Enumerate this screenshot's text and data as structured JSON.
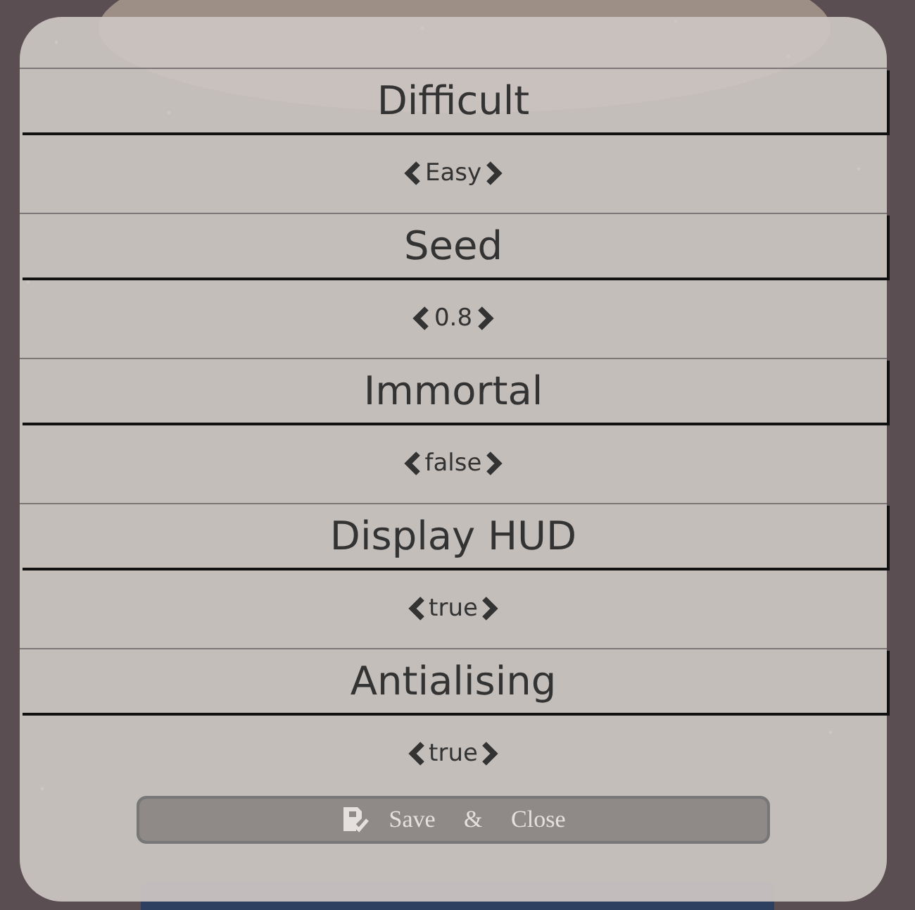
{
  "settings": [
    {
      "label": "Difficult",
      "value": "Easy"
    },
    {
      "label": "Seed",
      "value": "0.8"
    },
    {
      "label": "Immortal",
      "value": "false"
    },
    {
      "label": "Display HUD",
      "value": "true"
    },
    {
      "label": "Antialising",
      "value": "true"
    }
  ],
  "save_button": "Save & Close"
}
